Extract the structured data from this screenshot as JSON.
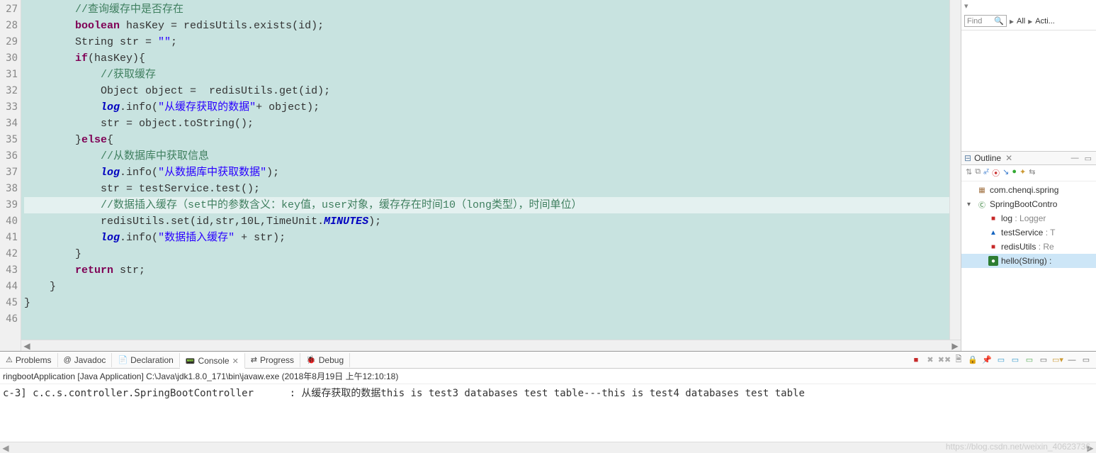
{
  "gutter_start": 27,
  "gutter_end": 46,
  "code_lines": [
    {
      "indent": "        ",
      "html": "<span class='cm'>//查询缓存中是否存在</span>"
    },
    {
      "indent": "        ",
      "html": "<span class='kw'>boolean</span> hasKey = redisUtils.exists(id);"
    },
    {
      "indent": "        ",
      "html": "String str = <span class='str'>\"\"</span>;"
    },
    {
      "indent": "        ",
      "html": "<span class='kw'>if</span>(hasKey){"
    },
    {
      "indent": "            ",
      "html": "<span class='cm'>//获取缓存</span>"
    },
    {
      "indent": "            ",
      "html": "Object object =  redisUtils.get(id);"
    },
    {
      "indent": "            ",
      "html": "<span class='fld'>log</span>.info(<span class='str'>\"从缓存获取的数据\"</span>+ object);"
    },
    {
      "indent": "            ",
      "html": "str = object.toString();"
    },
    {
      "indent": "        ",
      "html": "}<span class='kw'>else</span>{"
    },
    {
      "indent": "            ",
      "html": "<span class='cm'>//从数据库中获取信息</span>"
    },
    {
      "indent": "            ",
      "html": "<span class='fld'>log</span>.info(<span class='str'>\"从数据库中获取数据\"</span>);"
    },
    {
      "indent": "            ",
      "html": "str = testService.test();"
    },
    {
      "indent": "            ",
      "html": "<span class='cm'>//数据插入缓存（set中的参数含义：key值，user对象，缓存存在时间10（long类型），时间单位）</span>",
      "hl": true
    },
    {
      "indent": "            ",
      "html": "redisUtils.set(id,str,10L,TimeUnit.<span class='stat'>MINUTES</span>);"
    },
    {
      "indent": "            ",
      "html": "<span class='fld'>log</span>.info(<span class='str'>\"数据插入缓存\"</span> + str);"
    },
    {
      "indent": "        ",
      "html": "}"
    },
    {
      "indent": "        ",
      "html": "<span class='kw'>return</span> str;"
    },
    {
      "indent": "    ",
      "html": "}"
    },
    {
      "indent": "",
      "html": "}"
    },
    {
      "indent": "",
      "html": ""
    }
  ],
  "find_placeholder": "Find",
  "breadcrumbs": [
    "All",
    "Acti..."
  ],
  "outline_title": "Outline",
  "outline_nodes": {
    "package": "com.chenqi.spring",
    "class": "SpringBootContro",
    "members": [
      {
        "kind": "field",
        "name": "log",
        "type": "Logger"
      },
      {
        "kind": "field-blue",
        "name": "testService",
        "type": "T"
      },
      {
        "kind": "field",
        "name": "redisUtils",
        "type": "Re"
      },
      {
        "kind": "method",
        "name": "hello(String)",
        "type": "",
        "sel": true
      }
    ]
  },
  "bottom_tabs": [
    {
      "icon": "⚠",
      "label": "Problems",
      "active": false
    },
    {
      "icon": "@",
      "label": "Javadoc",
      "active": false
    },
    {
      "icon": "📄",
      "label": "Declaration",
      "active": false
    },
    {
      "icon": "📟",
      "label": "Console",
      "active": true,
      "closable": true
    },
    {
      "icon": "⇄",
      "label": "Progress",
      "active": false
    },
    {
      "icon": "🐞",
      "label": "Debug",
      "active": false
    }
  ],
  "console_subtitle": "ringbootApplication [Java Application] C:\\Java\\jdk1.8.0_171\\bin\\javaw.exe (2018年8月19日 上午12:10:18)",
  "console_line": "c-3] c.c.s.controller.SpringBootController      : 从缓存获取的数据this is test3 databases test table---this is test4 databases test table",
  "watermark": "https://blog.csdn.net/weixin_40623736"
}
